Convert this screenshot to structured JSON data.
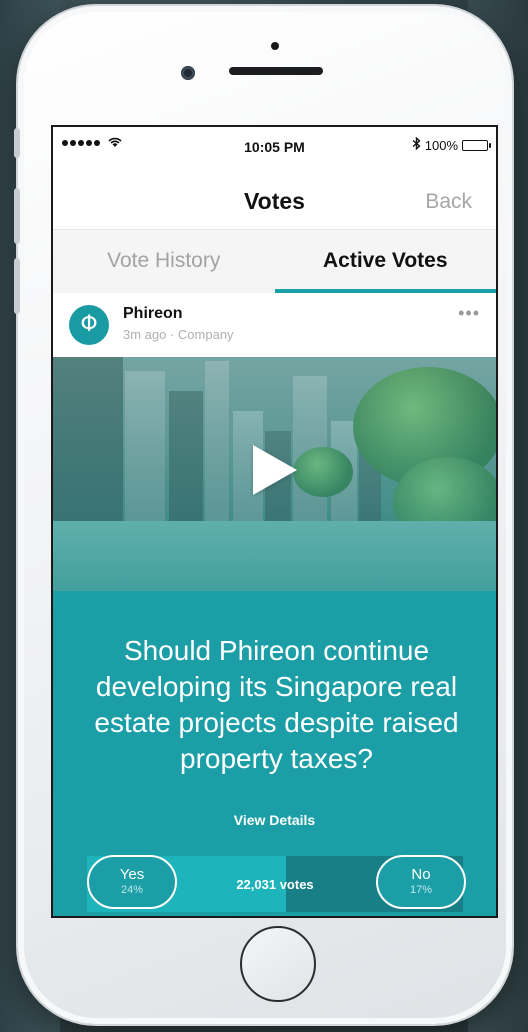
{
  "status_bar": {
    "time": "10:05 PM",
    "battery_text": "100%",
    "bluetooth_icon": "bluetooth",
    "wifi_icon": "wifi"
  },
  "nav": {
    "title": "Votes",
    "back_label": "Back"
  },
  "tabs": [
    {
      "label": "Vote History",
      "active": false
    },
    {
      "label": "Active Votes",
      "active": true
    }
  ],
  "post": {
    "avatar_glyph": "Φ",
    "author": "Phireon",
    "meta": "3m ago · Company",
    "more_label": "•••"
  },
  "media": {
    "play_icon": "play"
  },
  "question": {
    "text": "Should Phireon continue developing its Singapore real estate projects despite raised property taxes?",
    "view_details": "View Details"
  },
  "vote": {
    "yes_label": "Yes",
    "yes_percent": "24%",
    "no_label": "No",
    "no_percent": "17%",
    "total": "22,031 votes",
    "yes_fill_fraction": 0.53
  },
  "colors": {
    "accent": "#1b9ea6",
    "tab_underline": "#1ba0a8"
  }
}
